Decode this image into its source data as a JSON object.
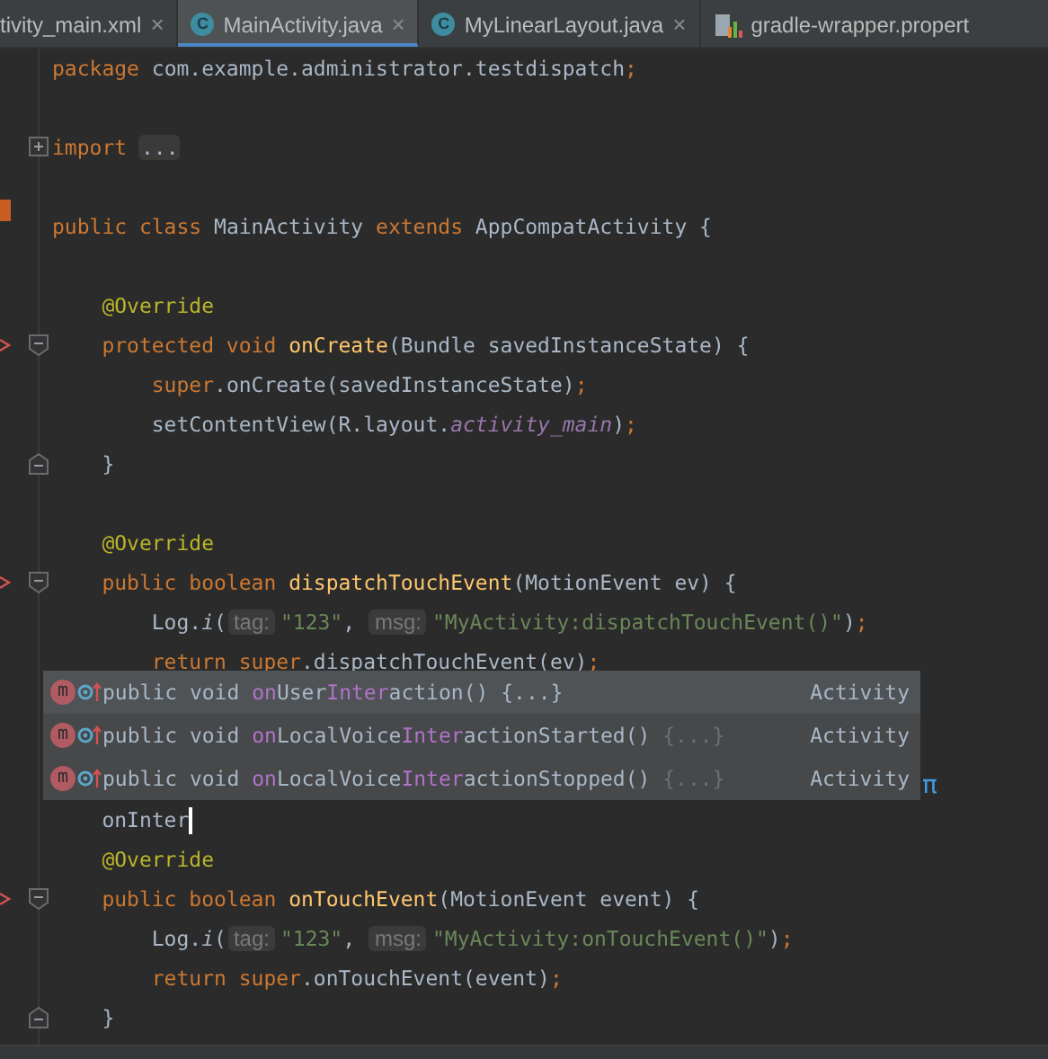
{
  "tabs": [
    {
      "label": "tivity_main.xml",
      "kind": "xml",
      "selected": false,
      "closable": true,
      "close_glyph": "×"
    },
    {
      "label": "MainActivity.java",
      "kind": "class",
      "icon_letter": "C",
      "selected": true,
      "closable": true,
      "close_glyph": "×"
    },
    {
      "label": "MyLinearLayout.java",
      "kind": "class",
      "icon_letter": "C",
      "selected": false,
      "closable": true,
      "close_glyph": "×"
    },
    {
      "label": "gradle-wrapper.propert",
      "kind": "gradle",
      "selected": false,
      "closable": false
    }
  ],
  "lines": [
    {
      "kind": "code",
      "tokens": [
        {
          "t": "package ",
          "kind": "kw"
        },
        {
          "t": "com.example.administrator.testdispatch",
          "kind": "plain"
        },
        {
          "t": ";",
          "kind": "kw"
        }
      ]
    },
    {
      "kind": "blank"
    },
    {
      "kind": "code",
      "gutter": [
        {
          "kind": "expand"
        }
      ],
      "tokens": [
        {
          "t": "import ",
          "kind": "kw"
        },
        {
          "t": "...",
          "kind": "folded"
        }
      ]
    },
    {
      "kind": "blank"
    },
    {
      "kind": "code",
      "gutter": [
        {
          "kind": "change"
        }
      ],
      "tokens": [
        {
          "t": "public class ",
          "kind": "kw"
        },
        {
          "t": "MainActivity ",
          "kind": "plain"
        },
        {
          "t": "extends ",
          "kind": "kw"
        },
        {
          "t": "AppCompatActivity {",
          "kind": "plain"
        }
      ]
    },
    {
      "kind": "blank"
    },
    {
      "kind": "code",
      "tokens": [
        {
          "t": "    @Override",
          "kind": "ann"
        }
      ]
    },
    {
      "kind": "code",
      "gutter": [
        {
          "kind": "override"
        },
        {
          "kind": "fold_start"
        }
      ],
      "tokens": [
        {
          "t": "    protected void ",
          "kind": "kw"
        },
        {
          "t": "onCreate",
          "kind": "method"
        },
        {
          "t": "(Bundle savedInstanceState) {",
          "kind": "plain"
        }
      ]
    },
    {
      "kind": "code",
      "tokens": [
        {
          "t": "        super",
          "kind": "kw"
        },
        {
          "t": ".onCreate(savedInstanceState)",
          "kind": "plain"
        },
        {
          "t": ";",
          "kind": "kw"
        }
      ]
    },
    {
      "kind": "code",
      "tokens": [
        {
          "t": "        setContentView(R.layout.",
          "kind": "plain"
        },
        {
          "t": "activity_main",
          "kind": "field"
        },
        {
          "t": ")",
          "kind": "plain"
        },
        {
          "t": ";",
          "kind": "kw"
        }
      ]
    },
    {
      "kind": "code",
      "gutter": [
        {
          "kind": "fold_end"
        }
      ],
      "tokens": [
        {
          "t": "    }",
          "kind": "plain"
        }
      ]
    },
    {
      "kind": "blank"
    },
    {
      "kind": "code",
      "tokens": [
        {
          "t": "    @Override",
          "kind": "ann"
        }
      ]
    },
    {
      "kind": "code",
      "gutter": [
        {
          "kind": "override"
        },
        {
          "kind": "fold_start"
        }
      ],
      "tokens": [
        {
          "t": "    public boolean ",
          "kind": "kw"
        },
        {
          "t": "dispatchTouchEvent",
          "kind": "method"
        },
        {
          "t": "(MotionEvent ev) {",
          "kind": "plain"
        }
      ]
    },
    {
      "kind": "code",
      "tokens": [
        {
          "t": "        Log.",
          "kind": "plain"
        },
        {
          "t": "i",
          "kind": "static"
        },
        {
          "t": "(",
          "kind": "plain"
        },
        {
          "t": "tag:",
          "kind": "hint"
        },
        {
          "t": "\"123\"",
          "kind": "str"
        },
        {
          "t": ", ",
          "kind": "plain"
        },
        {
          "t": "msg:",
          "kind": "hint"
        },
        {
          "t": "\"MyActivity:dispatchTouchEvent()\"",
          "kind": "str"
        },
        {
          "t": ")",
          "kind": "plain"
        },
        {
          "t": ";",
          "kind": "kw"
        }
      ]
    },
    {
      "kind": "code",
      "tokens": [
        {
          "t": "        return super",
          "kind": "kw"
        },
        {
          "t": ".dispatchTouchEvent(ev)",
          "kind": "plain"
        },
        {
          "t": ";",
          "kind": "kw"
        }
      ]
    },
    {
      "kind": "blank"
    },
    {
      "kind": "blank"
    },
    {
      "kind": "blank"
    },
    {
      "kind": "code",
      "caret": true,
      "tokens": [
        {
          "t": "    onInter",
          "kind": "plain"
        }
      ]
    },
    {
      "kind": "code",
      "tokens": [
        {
          "t": "    @Override",
          "kind": "ann"
        }
      ]
    },
    {
      "kind": "code",
      "gutter": [
        {
          "kind": "override"
        },
        {
          "kind": "fold_start"
        }
      ],
      "tokens": [
        {
          "t": "    public boolean ",
          "kind": "kw"
        },
        {
          "t": "onTouchEvent",
          "kind": "method"
        },
        {
          "t": "(MotionEvent event) {",
          "kind": "plain"
        }
      ]
    },
    {
      "kind": "code",
      "tokens": [
        {
          "t": "        Log.",
          "kind": "plain"
        },
        {
          "t": "i",
          "kind": "static"
        },
        {
          "t": "(",
          "kind": "plain"
        },
        {
          "t": "tag:",
          "kind": "hint"
        },
        {
          "t": "\"123\"",
          "kind": "str"
        },
        {
          "t": ", ",
          "kind": "plain"
        },
        {
          "t": "msg:",
          "kind": "hint"
        },
        {
          "t": "\"MyActivity:onTouchEvent()\"",
          "kind": "str"
        },
        {
          "t": ")",
          "kind": "plain"
        },
        {
          "t": ";",
          "kind": "kw"
        }
      ]
    },
    {
      "kind": "code",
      "tokens": [
        {
          "t": "        return super",
          "kind": "kw"
        },
        {
          "t": ".onTouchEvent(event)",
          "kind": "plain"
        },
        {
          "t": ";",
          "kind": "kw"
        }
      ]
    },
    {
      "kind": "code",
      "gutter": [
        {
          "kind": "fold_end"
        }
      ],
      "tokens": [
        {
          "t": "    }",
          "kind": "plain"
        }
      ]
    }
  ],
  "completion": {
    "corner_glyph": "π",
    "items": [
      {
        "icon_letter": "m",
        "selected": true,
        "parts": [
          {
            "t": "public void ",
            "match": false
          },
          {
            "t": "on",
            "match": true
          },
          {
            "t": "User",
            "match": false
          },
          {
            "t": "Inter",
            "match": true
          },
          {
            "t": "action() ",
            "match": false
          }
        ],
        "body": "{...}",
        "type": "Activity"
      },
      {
        "icon_letter": "m",
        "selected": false,
        "parts": [
          {
            "t": "public void ",
            "match": false
          },
          {
            "t": "on",
            "match": true
          },
          {
            "t": "LocalVoice",
            "match": false
          },
          {
            "t": "Inter",
            "match": true
          },
          {
            "t": "actionStarted() ",
            "match": false
          }
        ],
        "body": "{...}",
        "type": "Activity"
      },
      {
        "icon_letter": "m",
        "selected": false,
        "parts": [
          {
            "t": "public void ",
            "match": false
          },
          {
            "t": "on",
            "match": true
          },
          {
            "t": "LocalVoice",
            "match": false
          },
          {
            "t": "Inter",
            "match": true
          },
          {
            "t": "actionStopped() ",
            "match": false
          }
        ],
        "body": "{...}",
        "type": "Activity"
      }
    ]
  }
}
